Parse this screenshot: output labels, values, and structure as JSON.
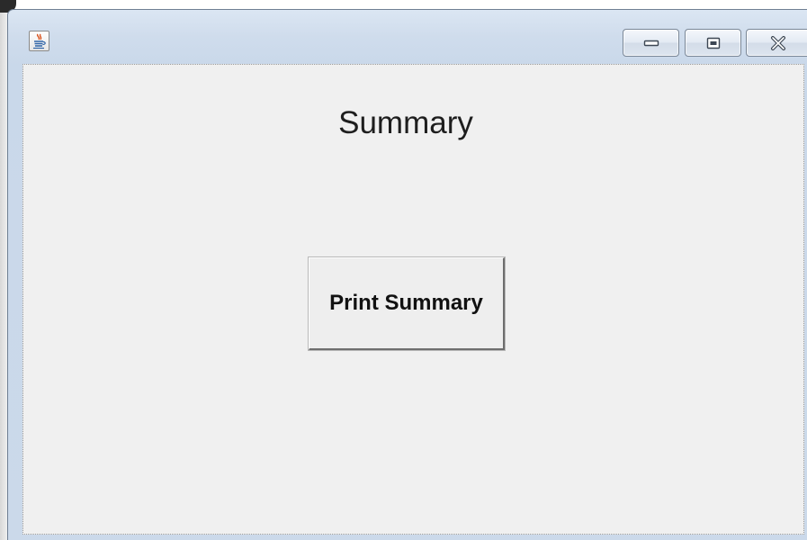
{
  "window": {
    "title": "",
    "app_icon": "java-coffee-icon",
    "controls": {
      "minimize_icon": "minimize-icon",
      "maximize_icon": "maximize-icon",
      "close_icon": "close-icon"
    }
  },
  "main": {
    "heading": "Summary",
    "print_button_label": "Print Summary"
  },
  "colors": {
    "content_background": "#f0f0f0",
    "title_bar": "#cfdcec",
    "text": "#1e1e1e"
  }
}
